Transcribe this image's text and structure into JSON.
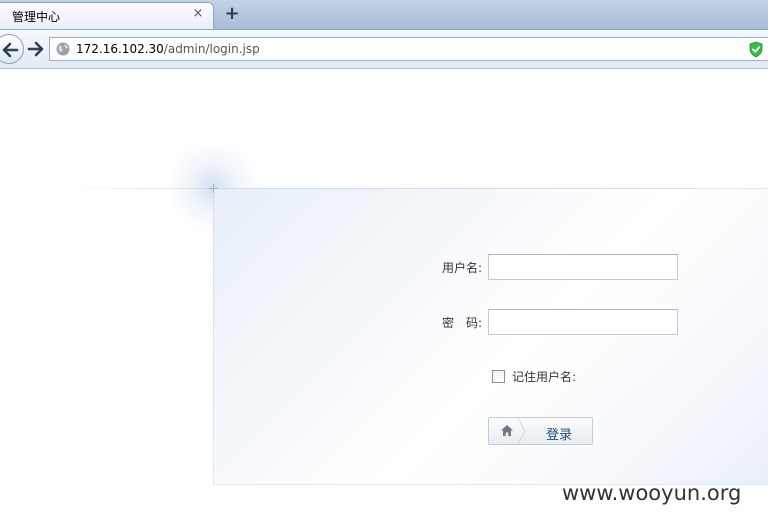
{
  "browser": {
    "tab_title": "管理中心",
    "tab_close": "×",
    "new_tab": "+",
    "url_host": "172.16.102.30",
    "url_path": "/admin/login.jsp"
  },
  "login": {
    "username_label": "用户名:",
    "password_label": "密　码:",
    "username_value": "",
    "password_value": "",
    "remember_label": "记住用户名:",
    "remember_checked": false,
    "submit_label": "登录"
  },
  "watermark": "www.wooyun.org",
  "colors": {
    "tabbar": "#a8bcd6",
    "button_text": "#1f4a7a",
    "panel_tint": "#e7eef7"
  },
  "icons": {
    "back": "back-arrow-icon",
    "forward": "forward-arrow-icon",
    "globe": "globe-icon",
    "shield": "shield-check-icon",
    "home": "home-icon"
  }
}
